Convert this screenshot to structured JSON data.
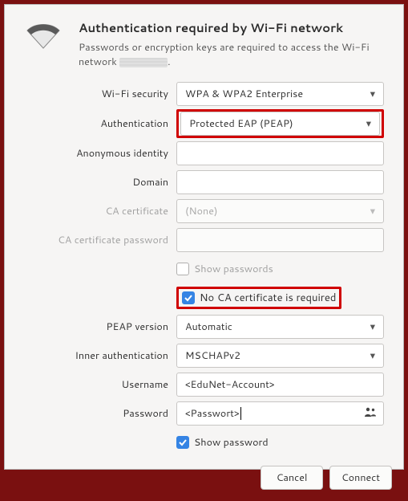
{
  "header": {
    "title": "Authentication required by Wi-Fi network",
    "subtitle_prefix": "Passwords or encryption keys are required to access the Wi-Fi network ",
    "subtitle_suffix": "."
  },
  "labels": {
    "wifi_security": "Wi-Fi security",
    "authentication": "Authentication",
    "anon_identity": "Anonymous identity",
    "domain": "Domain",
    "ca_cert": "CA certificate",
    "ca_cert_password": "CA certificate password",
    "show_passwords": "Show passwords",
    "no_ca_required": "No CA certificate is required",
    "peap_version": "PEAP version",
    "inner_auth": "Inner authentication",
    "username": "Username",
    "password": "Password",
    "show_password": "Show password"
  },
  "values": {
    "wifi_security": "WPA & WPA2 Enterprise",
    "authentication": "Protected EAP (PEAP)",
    "anon_identity": "",
    "domain": "",
    "ca_cert": "(None)",
    "ca_cert_password": "",
    "show_passwords_checked": false,
    "no_ca_required_checked": true,
    "peap_version": "Automatic",
    "inner_auth": "MSCHAPv2",
    "username": "<EduNet-Account>",
    "password": "<Passwort>",
    "show_password_checked": true
  },
  "buttons": {
    "cancel": "Cancel",
    "connect": "Connect"
  }
}
